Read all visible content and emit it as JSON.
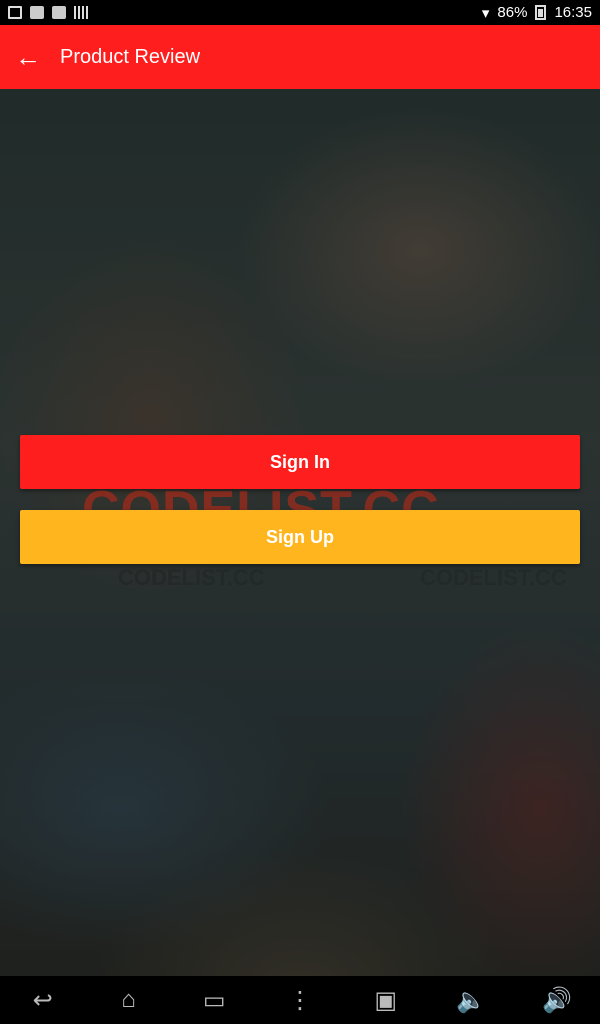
{
  "status_bar": {
    "battery": "86%",
    "time": "16:35"
  },
  "app_bar": {
    "back_icon": "arrow-back-icon",
    "title": "Product Review",
    "color": "#ff1e1e"
  },
  "watermark": {
    "text": "CODELIST.CC"
  },
  "buttons": {
    "sign_in": "Sign In",
    "sign_up": "Sign Up",
    "sign_in_color": "#ff1e1e",
    "sign_up_color": "#ffb61e"
  },
  "nav_bar": {
    "icons": [
      "back-icon",
      "home-icon",
      "recents-icon",
      "menu-dots-icon",
      "screenshot-icon",
      "volume-down-icon",
      "volume-up-icon"
    ]
  }
}
